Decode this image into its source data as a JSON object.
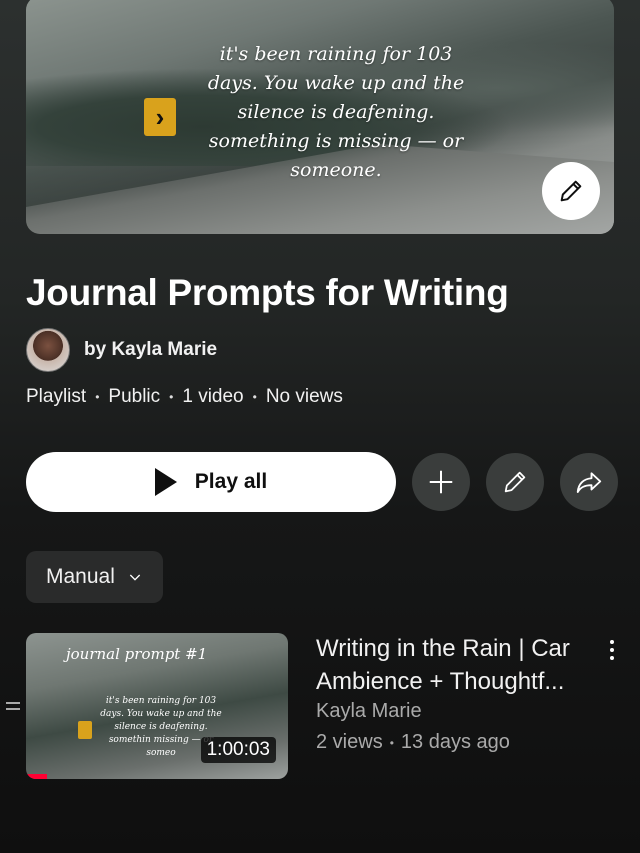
{
  "playlist": {
    "thumbnail_caption": "it's been raining for 103 days. You wake up and the silence is deafening. something is missing — or someone.",
    "title": "Journal Prompts for Writing",
    "owner": "by Kayla Marie",
    "meta": [
      "Playlist",
      "Public",
      "1 video",
      "No views"
    ]
  },
  "actions": {
    "play_all_label": "Play all",
    "icons": [
      "plus-icon",
      "pencil-icon",
      "share-icon"
    ]
  },
  "sort": {
    "label": "Manual"
  },
  "videos": [
    {
      "title": "Writing in the Rain | Car Ambience + Thoughtf...",
      "channel": "Kayla Marie",
      "views": "2 views",
      "age": "13 days ago",
      "duration": "1:00:03",
      "thumb_title": "journal prompt #1",
      "thumb_caption": "it's been raining for 103 days. You wake up and the silence is deafening. somethin missing — or someo",
      "watched_fraction": 0.08
    }
  ],
  "colors": {
    "accent": "#ff0033",
    "background": "#0f0f0f"
  }
}
